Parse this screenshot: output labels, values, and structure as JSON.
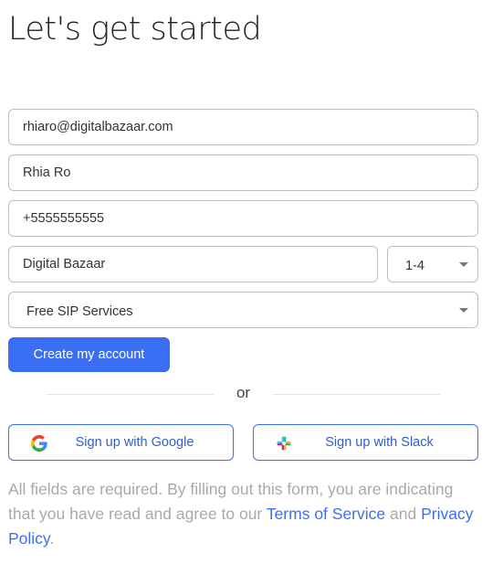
{
  "heading": "Let's get started",
  "form": {
    "email_value": "rhiaro@digitalbazaar.com",
    "name_value": "Rhia Ro",
    "phone_value": "+5555555555",
    "company_value": "Digital Bazaar",
    "company_size_value": "1-4",
    "interest_value": "Free SIP Services",
    "submit_label": "Create my account"
  },
  "divider_text": "or",
  "social": {
    "google_label": "Sign up with Google",
    "slack_label": "Sign up with Slack"
  },
  "legal": {
    "text_before": "All fields are required. By filling out this form, you are indicating that you have read and agree to our ",
    "terms_link": "Terms of Service",
    "text_middle": " and ",
    "privacy_link": "Privacy Policy",
    "text_after": "."
  },
  "colors": {
    "accent": "#3b6ff3",
    "border": "#bdbdbd",
    "muted_text": "#a9a9a9"
  }
}
